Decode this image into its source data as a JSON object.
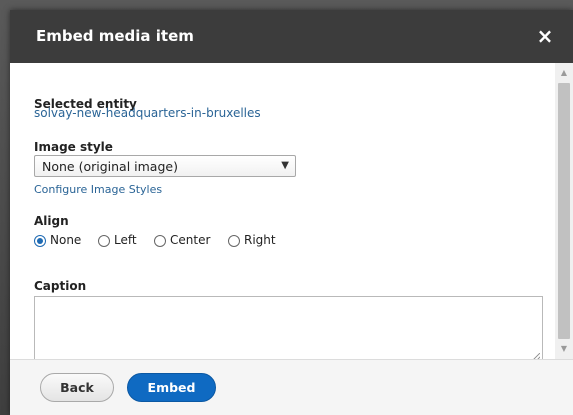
{
  "dialog": {
    "title": "Embed media item",
    "close_glyph": "×"
  },
  "selected_entity": {
    "label": "Selected entity",
    "value": "solvay-new-headquarters-in-bruxelles"
  },
  "image_style": {
    "label": "Image style",
    "selected": "None (original image)",
    "configure_link": "Configure Image Styles"
  },
  "align": {
    "label": "Align",
    "options": [
      {
        "label": "None",
        "checked": true
      },
      {
        "label": "Left",
        "checked": false
      },
      {
        "label": "Center",
        "checked": false
      },
      {
        "label": "Right",
        "checked": false
      }
    ]
  },
  "caption": {
    "label": "Caption",
    "value": ""
  },
  "buttons": {
    "back": "Back",
    "embed": "Embed"
  },
  "colors": {
    "titlebar": "#3c3c3c",
    "link": "#2a6496",
    "primary": "#0f6ac2",
    "radio_checked": "#1e6ab3"
  }
}
